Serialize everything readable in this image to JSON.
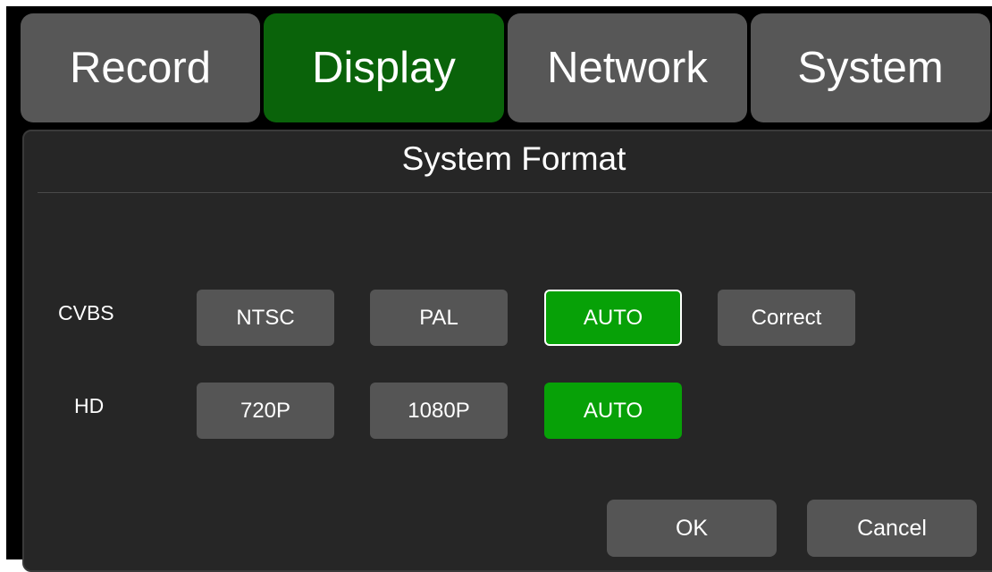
{
  "tabs": [
    {
      "label": "Record",
      "active": false
    },
    {
      "label": "Display",
      "active": true
    },
    {
      "label": "Network",
      "active": false
    },
    {
      "label": "System",
      "active": false
    }
  ],
  "panel": {
    "title": "System Format",
    "rows": [
      {
        "label": "CVBS",
        "options": [
          "NTSC",
          "PAL",
          "AUTO",
          "Correct"
        ],
        "selected": "AUTO"
      },
      {
        "label": "HD",
        "options": [
          "720P",
          "1080P",
          "AUTO"
        ],
        "selected": "AUTO"
      }
    ],
    "ok_label": "OK",
    "cancel_label": "Cancel"
  },
  "colors": {
    "active_tab": "#0a630a",
    "selected_option": "#07a107",
    "button": "#555555",
    "tab": "#575757",
    "panel": "#262626"
  }
}
